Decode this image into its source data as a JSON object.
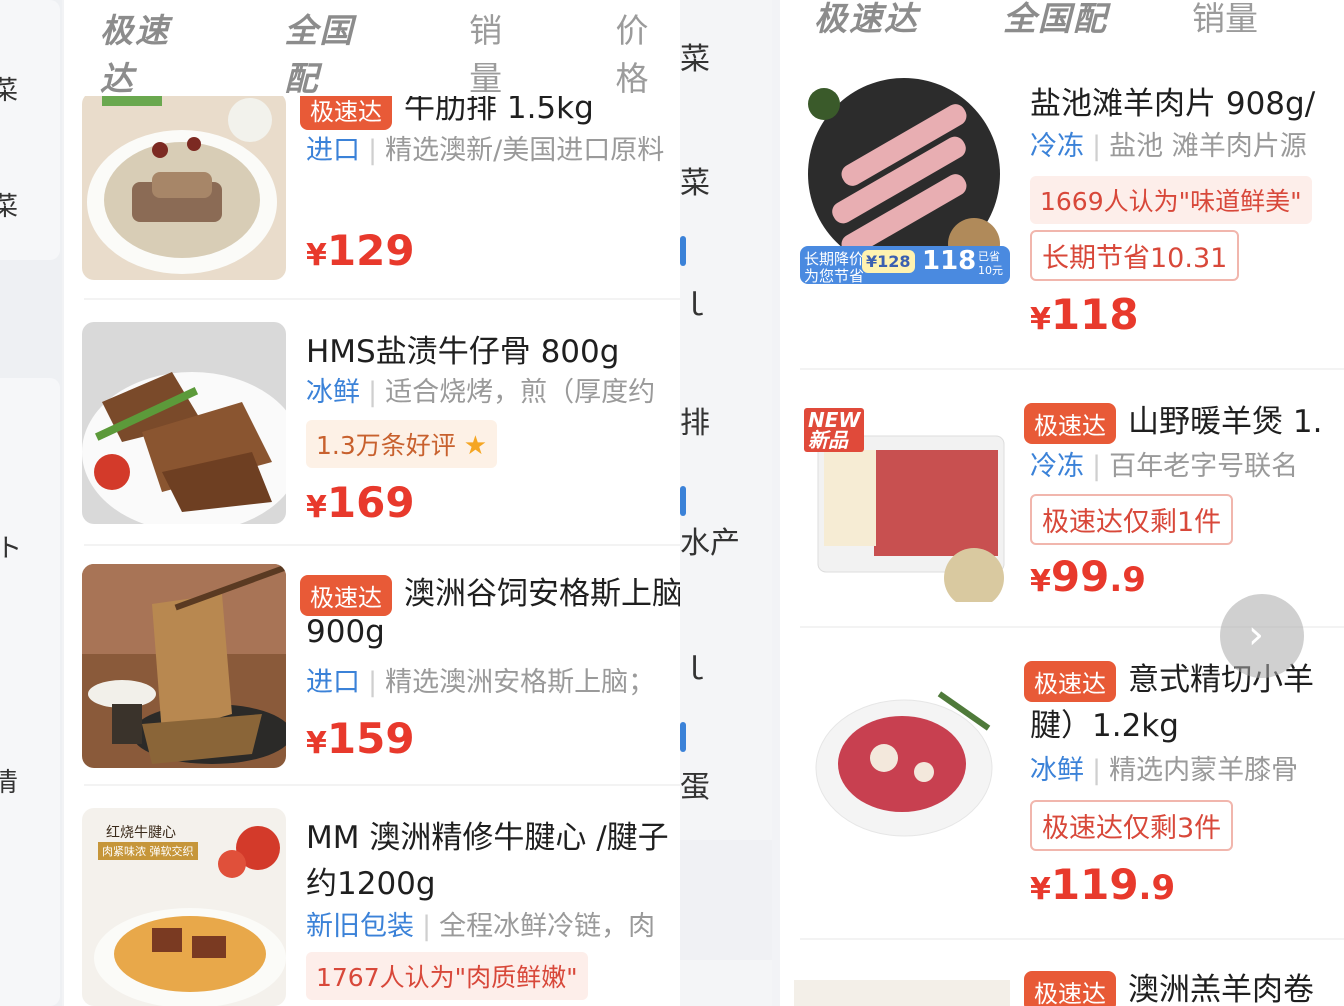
{
  "left": {
    "sidebar_chars": [
      "菜",
      "菜",
      "ト",
      "清"
    ],
    "tabs": [
      "极速达",
      "全国配",
      "销量",
      "价格"
    ],
    "overlap_tab": "菜",
    "items": [
      {
        "tag": "极速达",
        "title": "牛肋排 1.5kg",
        "kw": "进口",
        "desc": "精选澳新/美国进口原料",
        "badge": "",
        "price_int": "129",
        "price_dec": ""
      },
      {
        "tag": "",
        "title": "HMS盐渍牛仔骨 800g",
        "kw": "冰鲜",
        "desc": "适合烧烤，煎（厚度约",
        "badge": "1.3万条好评",
        "price_int": "169",
        "price_dec": ""
      },
      {
        "tag": "极速达",
        "title": "澳洲谷饲安格斯上脑",
        "title2": "900g",
        "kw": "进口",
        "desc": "精选澳洲安格斯上脑；",
        "badge": "",
        "price_int": "159",
        "price_dec": ""
      },
      {
        "tag": "",
        "title": "MM 澳洲精修牛腱心 /腱子",
        "title2": "约1200g",
        "kw": "新旧包装",
        "desc": "全程冰鲜冷链，肉",
        "badge": "1767人认为\"肉质鲜嫩\"",
        "price_int": "",
        "price_dec": ""
      }
    ],
    "img_text_1": "红烧牛腱心",
    "img_text_2": "肉紧味浓 弹软交织"
  },
  "mid": {
    "chars": [
      "菜",
      "菜",
      "ｌ",
      "排",
      "水产",
      "ｌ",
      "蛋"
    ]
  },
  "right": {
    "tabs": [
      "极速达",
      "全国配",
      "销量"
    ],
    "items": [
      {
        "tag": "",
        "title": "盐池滩羊肉片 908g/",
        "kw": "冷冻",
        "desc": "盐池 滩羊肉片源",
        "rank": "1669人认为\"味道鲜美\"",
        "out": "长期节省10.31",
        "price_int": "118",
        "price_dec": "",
        "promo_left": "长期降价",
        "promo_sub": "为您节省",
        "promo_from": "¥128",
        "promo_to": "118",
        "promo_save": "已省10元"
      },
      {
        "tag": "极速达",
        "title": "山野暖羊煲 1.",
        "kw": "冷冻",
        "desc": "百年老字号联名",
        "rank": "",
        "out": "极速达仅剩1件",
        "price_int": "99",
        "price_dec": ".9",
        "new_top": "NEW",
        "new_bottom": "新品"
      },
      {
        "tag": "极速达",
        "title": "意式精切小羊",
        "title2": "腱）1.2kg",
        "kw": "冰鲜",
        "desc": "精选内蒙羊膝骨",
        "rank": "",
        "out": "极速达仅剩3件",
        "price_int": "119",
        "price_dec": ".9"
      },
      {
        "tag": "极速达",
        "title": "澳洲羔羊肉卷",
        "kw": "",
        "desc": "",
        "rank": "",
        "out": "",
        "price_int": "",
        "price_dec": ""
      }
    ],
    "next_glyph": "›"
  },
  "currency": "¥",
  "colors": {
    "price": "#e8392c",
    "tag": "#e85a37",
    "keyword": "#3b82d8"
  }
}
